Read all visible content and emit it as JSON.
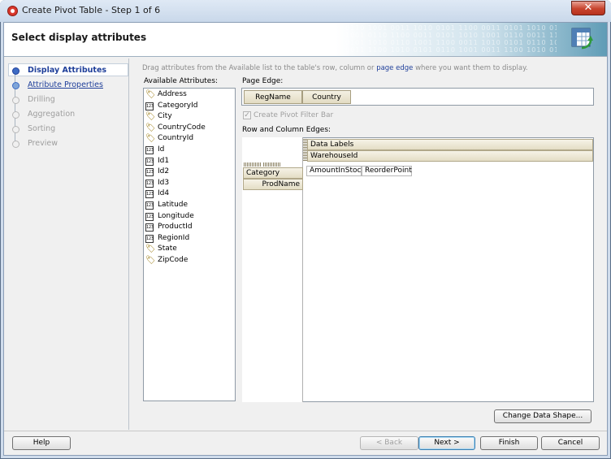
{
  "window": {
    "title": "Create Pivot Table - Step 1 of 6",
    "close_glyph": "✕"
  },
  "header": {
    "title": "Select display attributes"
  },
  "nav": {
    "items": [
      {
        "label": "Display Attributes",
        "state": "current"
      },
      {
        "label": "Attribute Properties",
        "state": "link"
      },
      {
        "label": "Drilling",
        "state": "disabled"
      },
      {
        "label": "Aggregation",
        "state": "disabled"
      },
      {
        "label": "Sorting",
        "state": "disabled"
      },
      {
        "label": "Preview",
        "state": "disabled"
      }
    ]
  },
  "instructions": {
    "before": "Drag attributes from the Available list to the table's row, column or ",
    "link": "page edge",
    "after": " where you want them to display."
  },
  "available": {
    "label": "Available Attributes:",
    "items": [
      {
        "name": "Address",
        "icon": "string-icon"
      },
      {
        "name": "CategoryId",
        "icon": "number-icon"
      },
      {
        "name": "City",
        "icon": "string-icon"
      },
      {
        "name": "CountryCode",
        "icon": "string-icon"
      },
      {
        "name": "CountryId",
        "icon": "string-icon"
      },
      {
        "name": "Id",
        "icon": "number-icon"
      },
      {
        "name": "Id1",
        "icon": "number-icon"
      },
      {
        "name": "Id2",
        "icon": "number-icon"
      },
      {
        "name": "Id3",
        "icon": "number-icon"
      },
      {
        "name": "Id4",
        "icon": "number-icon"
      },
      {
        "name": "Latitude",
        "icon": "number-icon"
      },
      {
        "name": "Longitude",
        "icon": "number-icon"
      },
      {
        "name": "ProductId",
        "icon": "number-icon"
      },
      {
        "name": "RegionId",
        "icon": "number-icon"
      },
      {
        "name": "State",
        "icon": "string-icon"
      },
      {
        "name": "ZipCode",
        "icon": "string-icon"
      }
    ]
  },
  "page_edge": {
    "label": "Page Edge:",
    "items": [
      "RegName",
      "Country"
    ]
  },
  "pivot_filter": {
    "label": "Create Pivot Filter Bar",
    "checked": true,
    "enabled": false
  },
  "row_col": {
    "label": "Row and Column Edges:",
    "column_headers": [
      "Data Labels",
      "WarehouseId"
    ],
    "row_headers": [
      "Category",
      "ProdName"
    ],
    "data_columns": [
      "AmountInStock",
      "ReorderPoint"
    ]
  },
  "buttons": {
    "change_data_shape": "Change Data Shape...",
    "help": "Help",
    "back": "< Back",
    "next": "Next >",
    "finish": "Finish",
    "cancel": "Cancel"
  },
  "colors": {
    "link": "#1f3f9a",
    "current_nav": "#1f3f9a",
    "disabled": "#9e9e9e"
  }
}
